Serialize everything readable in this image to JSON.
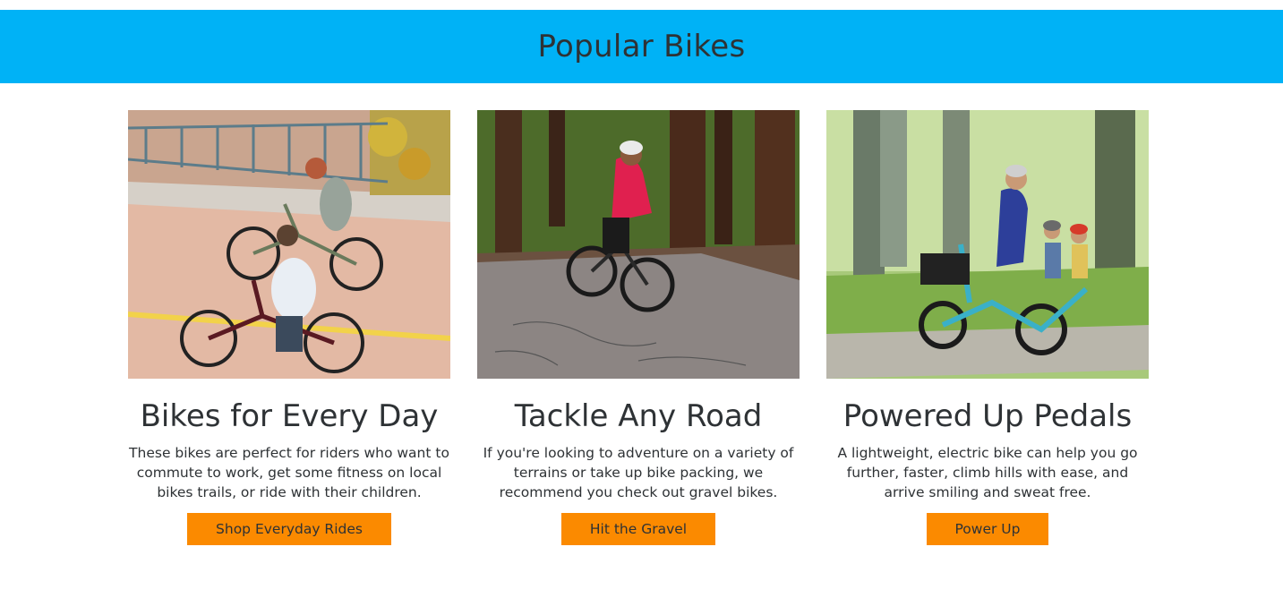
{
  "header": {
    "title": "Popular Bikes"
  },
  "colors": {
    "banner": "#00b2f6",
    "button": "#fb8a00",
    "text": "#2e3235"
  },
  "cards": [
    {
      "image": "photo of two commuters riding bikes on a path",
      "title": "Bikes for Every Day",
      "description": "These bikes are perfect for riders who want to commute to work, get some fitness on local bikes trails, or ride with their children.",
      "button_label": "Shop Everyday Rides"
    },
    {
      "image": "photo of a cyclist in pink jacket on a forest road",
      "title": "Tackle Any Road",
      "description": "If you're looking to adventure on a variety of terrains or take up bike packing, we recommend you check out gravel bikes.",
      "button_label": "Hit the Gravel"
    },
    {
      "image": "photo of a parent riding an electric cargo bike with two children",
      "title": "Powered Up Pedals",
      "description": "A lightweight, electric bike can help you go further, faster, climb hills with ease, and arrive smiling and sweat free.",
      "button_label": "Power Up"
    }
  ]
}
